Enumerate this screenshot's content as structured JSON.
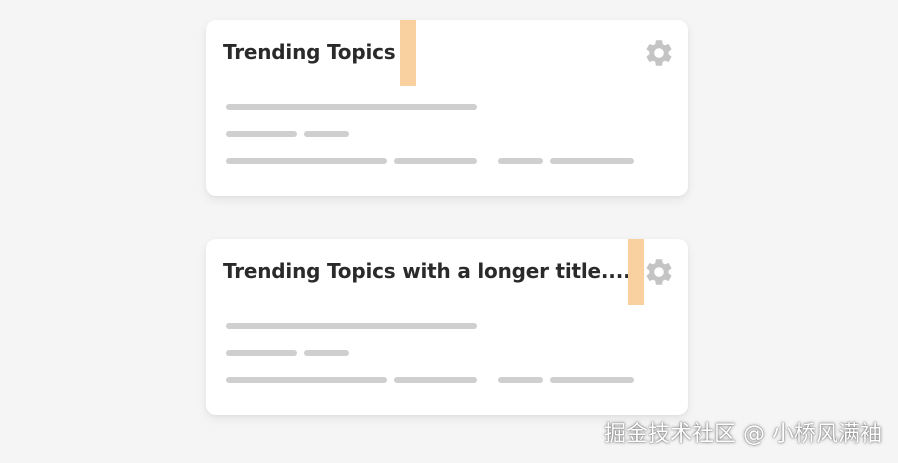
{
  "cards": [
    {
      "title": "Trending Topics",
      "settings_icon": "gear-icon"
    },
    {
      "title": "Trending Topics with a longer title.....",
      "settings_icon": "gear-icon"
    }
  ],
  "watermark": "掘金技术社区 @ 小桥风满袖",
  "colors": {
    "page_background": "#f5f5f5",
    "card_background": "#ffffff",
    "title_text": "#2a2a2a",
    "placeholder_line": "#cfcfcf",
    "highlight_marker": "#f9d1a0",
    "icon": "#c4c4c4"
  }
}
